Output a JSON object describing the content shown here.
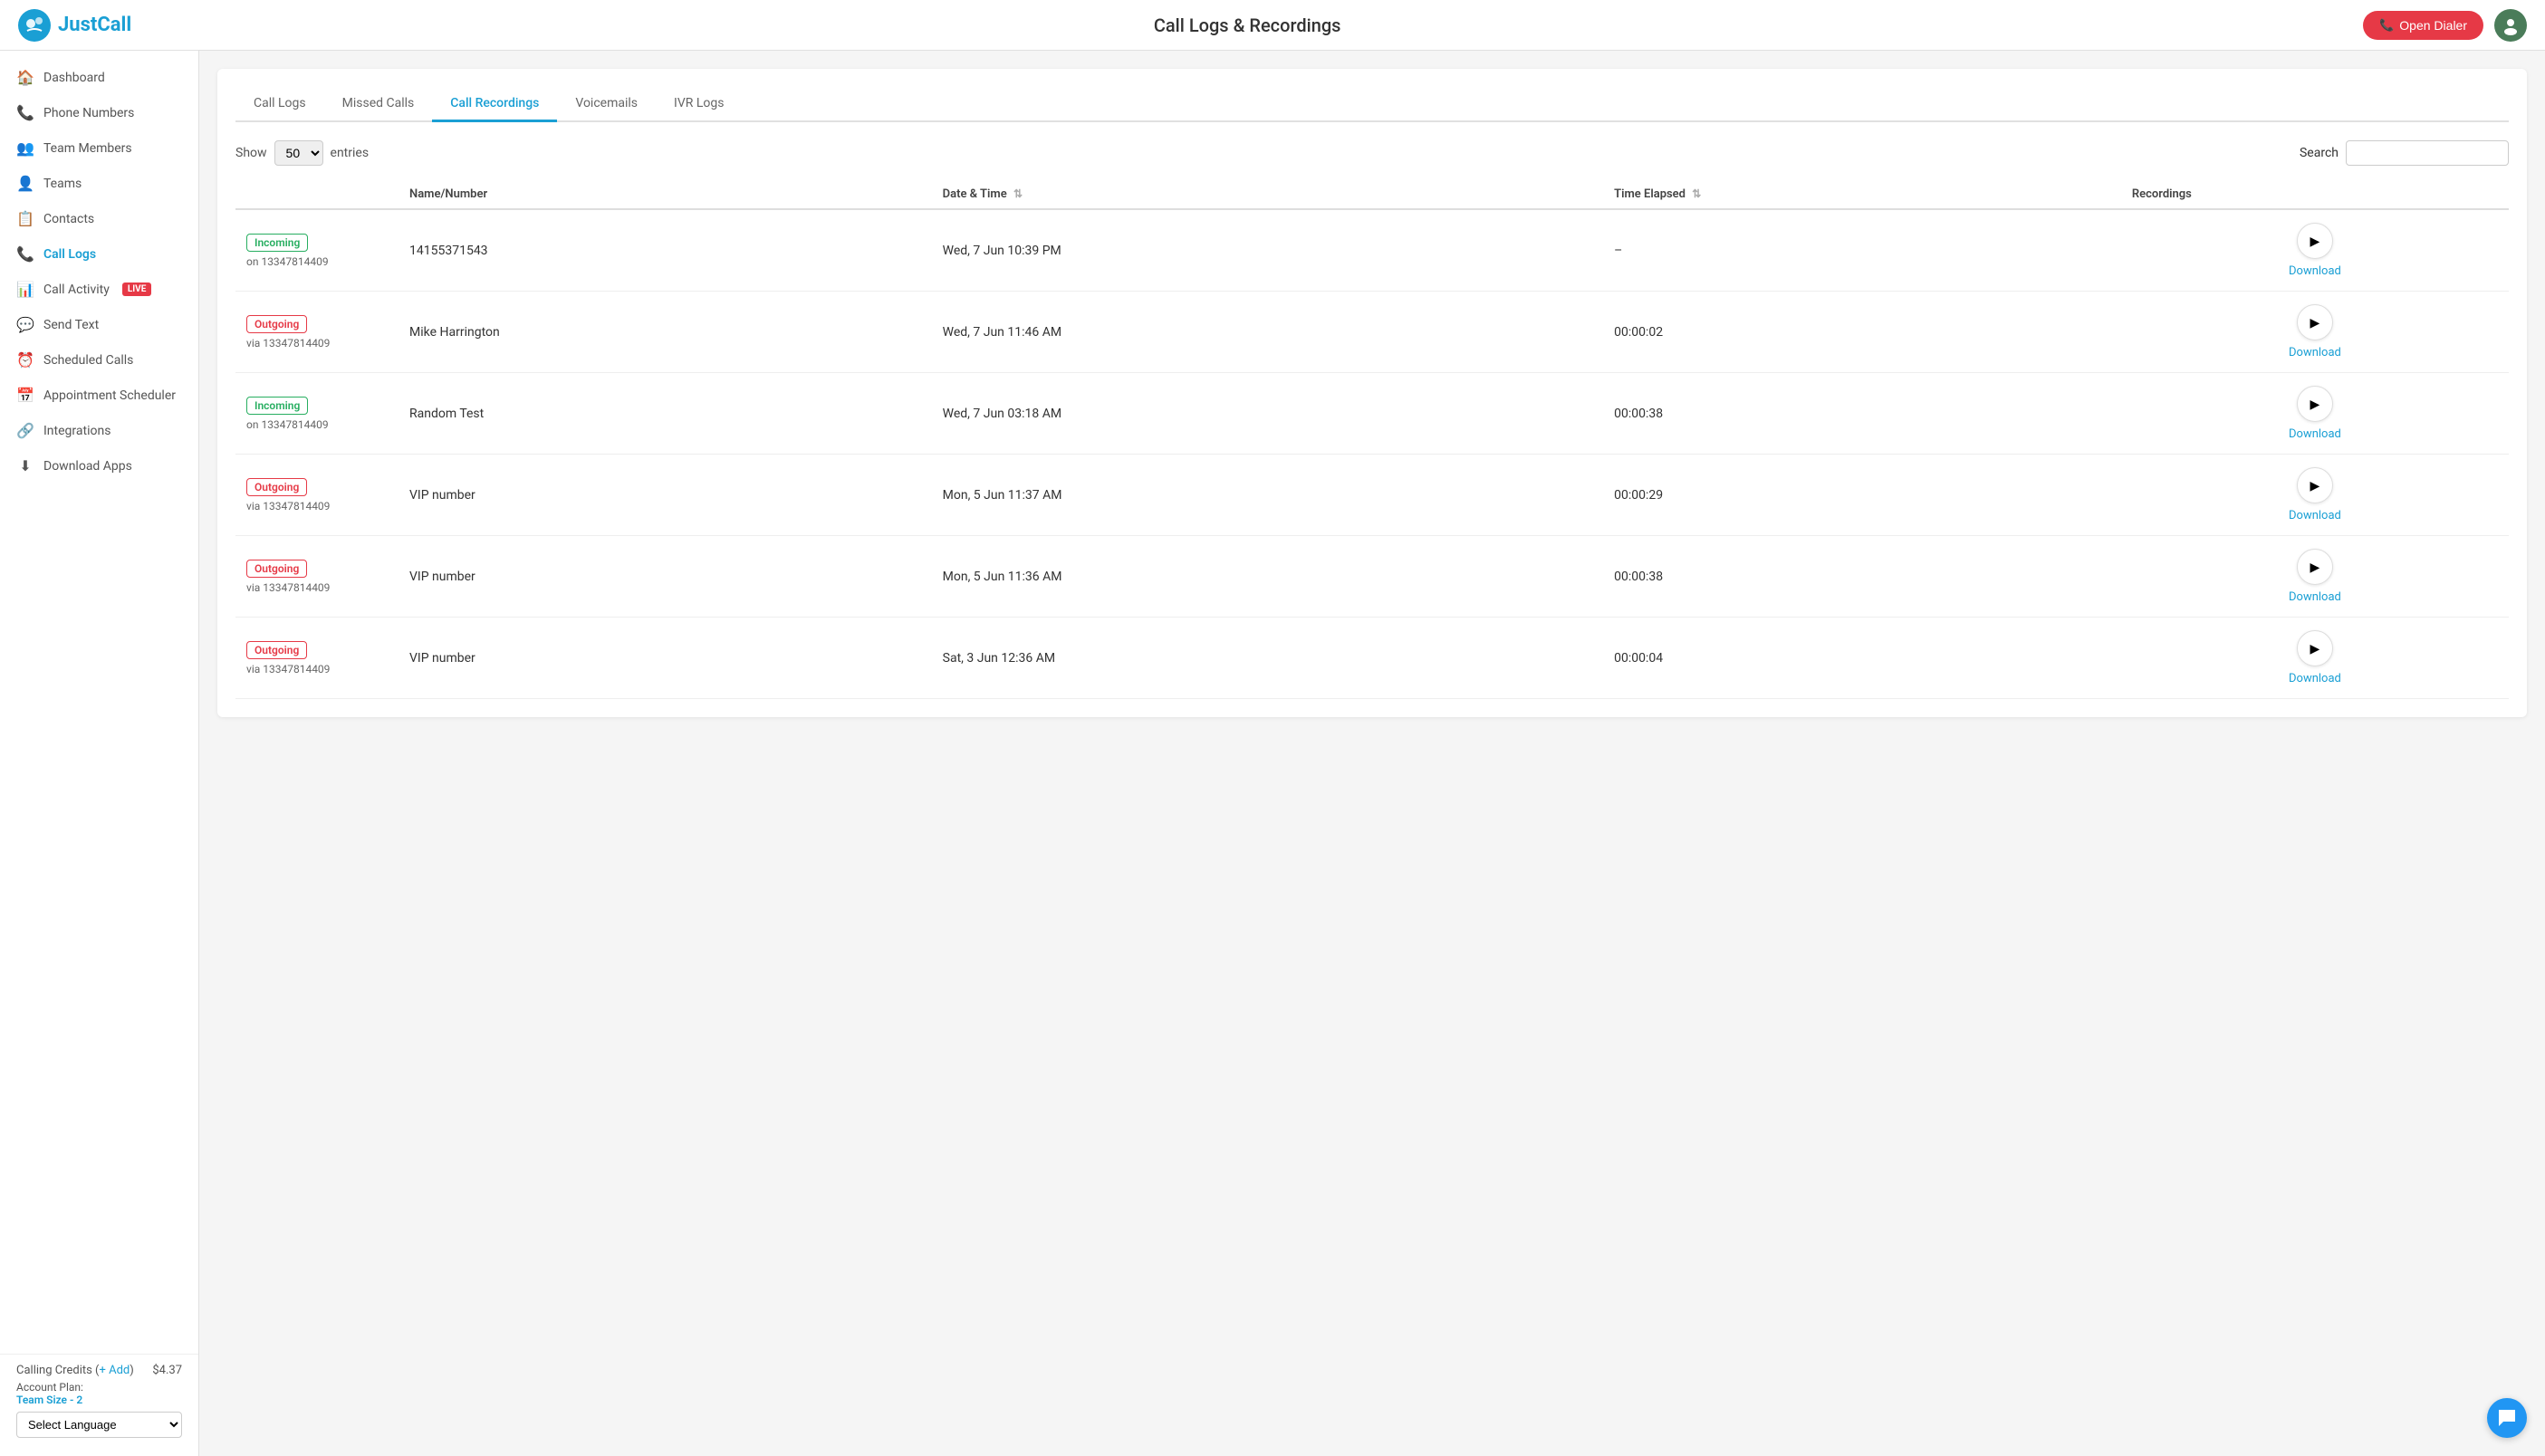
{
  "app": {
    "name": "JustCall",
    "page_title": "Call Logs & Recordings"
  },
  "header": {
    "open_dialer_label": "Open Dialer",
    "avatar_emoji": "👤"
  },
  "sidebar": {
    "items": [
      {
        "id": "dashboard",
        "label": "Dashboard",
        "icon": "🏠",
        "active": false
      },
      {
        "id": "phone-numbers",
        "label": "Phone Numbers",
        "icon": "📞",
        "active": false
      },
      {
        "id": "team-members",
        "label": "Team Members",
        "icon": "👥",
        "active": false
      },
      {
        "id": "teams",
        "label": "Teams",
        "icon": "👤",
        "active": false
      },
      {
        "id": "contacts",
        "label": "Contacts",
        "icon": "📋",
        "active": false
      },
      {
        "id": "call-logs",
        "label": "Call Logs",
        "icon": "📞",
        "active": true
      },
      {
        "id": "call-activity",
        "label": "Call Activity",
        "icon": "📊",
        "active": false,
        "badge": "LIVE"
      },
      {
        "id": "send-text",
        "label": "Send Text",
        "icon": "💬",
        "active": false
      },
      {
        "id": "scheduled-calls",
        "label": "Scheduled Calls",
        "icon": "⏰",
        "active": false
      },
      {
        "id": "appointment-scheduler",
        "label": "Appointment Scheduler",
        "icon": "📅",
        "active": false
      },
      {
        "id": "integrations",
        "label": "Integrations",
        "icon": "🔗",
        "active": false
      },
      {
        "id": "download-apps",
        "label": "Download Apps",
        "icon": "⬇",
        "active": false
      }
    ],
    "footer": {
      "credits_label": "Calling Credits",
      "add_label": "+ Add",
      "credits_value": "$4.37",
      "account_plan_label": "Account Plan:",
      "plan_name": "Team Size - 2",
      "language_options": [
        "Select Language"
      ],
      "language_default": "Select Language"
    }
  },
  "tabs": [
    {
      "id": "call-logs",
      "label": "Call Logs",
      "active": false
    },
    {
      "id": "missed-calls",
      "label": "Missed Calls",
      "active": false
    },
    {
      "id": "call-recordings",
      "label": "Call Recordings",
      "active": true
    },
    {
      "id": "voicemails",
      "label": "Voicemails",
      "active": false
    },
    {
      "id": "ivr-logs",
      "label": "IVR Logs",
      "active": false
    }
  ],
  "table_controls": {
    "show_label": "Show",
    "entries_value": "50",
    "entries_label": "entries",
    "search_label": "Search",
    "search_placeholder": ""
  },
  "table": {
    "columns": [
      {
        "id": "type",
        "label": ""
      },
      {
        "id": "name",
        "label": "Name/Number"
      },
      {
        "id": "datetime",
        "label": "Date & Time",
        "sortable": true
      },
      {
        "id": "elapsed",
        "label": "Time Elapsed",
        "sortable": true
      },
      {
        "id": "recordings",
        "label": "Recordings"
      }
    ],
    "rows": [
      {
        "direction": "Incoming",
        "direction_type": "incoming",
        "via_label": "on",
        "via_number": "13347814409",
        "name_number": "14155371543",
        "datetime": "Wed, 7 Jun 10:39 PM",
        "elapsed": "–",
        "download_label": "Download"
      },
      {
        "direction": "Outgoing",
        "direction_type": "outgoing",
        "via_label": "via",
        "via_number": "13347814409",
        "name_number": "Mike Harrington",
        "datetime": "Wed, 7 Jun 11:46 AM",
        "elapsed": "00:00:02",
        "download_label": "Download"
      },
      {
        "direction": "Incoming",
        "direction_type": "incoming",
        "via_label": "on",
        "via_number": "13347814409",
        "name_number": "Random Test",
        "datetime": "Wed, 7 Jun 03:18 AM",
        "elapsed": "00:00:38",
        "download_label": "Download"
      },
      {
        "direction": "Outgoing",
        "direction_type": "outgoing",
        "via_label": "via",
        "via_number": "13347814409",
        "name_number": "VIP number",
        "datetime": "Mon, 5 Jun 11:37 AM",
        "elapsed": "00:00:29",
        "download_label": "Download"
      },
      {
        "direction": "Outgoing",
        "direction_type": "outgoing",
        "via_label": "via",
        "via_number": "13347814409",
        "name_number": "VIP number",
        "datetime": "Mon, 5 Jun 11:36 AM",
        "elapsed": "00:00:38",
        "download_label": "Download"
      },
      {
        "direction": "Outgoing",
        "direction_type": "outgoing",
        "via_label": "via",
        "via_number": "13347814409",
        "name_number": "VIP number",
        "datetime": "Sat, 3 Jun 12:36 AM",
        "elapsed": "00:00:04",
        "download_label": "Download"
      }
    ]
  }
}
